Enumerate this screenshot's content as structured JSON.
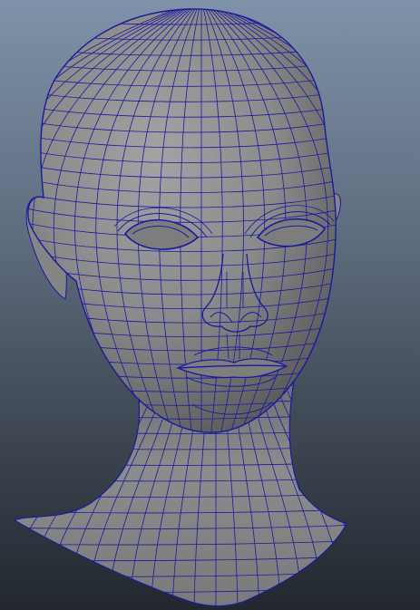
{
  "viewport": {
    "background_top": "#7f92a9",
    "background_bottom": "#23282f",
    "mesh_surface_color": "#8a8a8a",
    "wireframe_color": "#1a1aa0",
    "subject": "head-wireframe-mesh"
  }
}
